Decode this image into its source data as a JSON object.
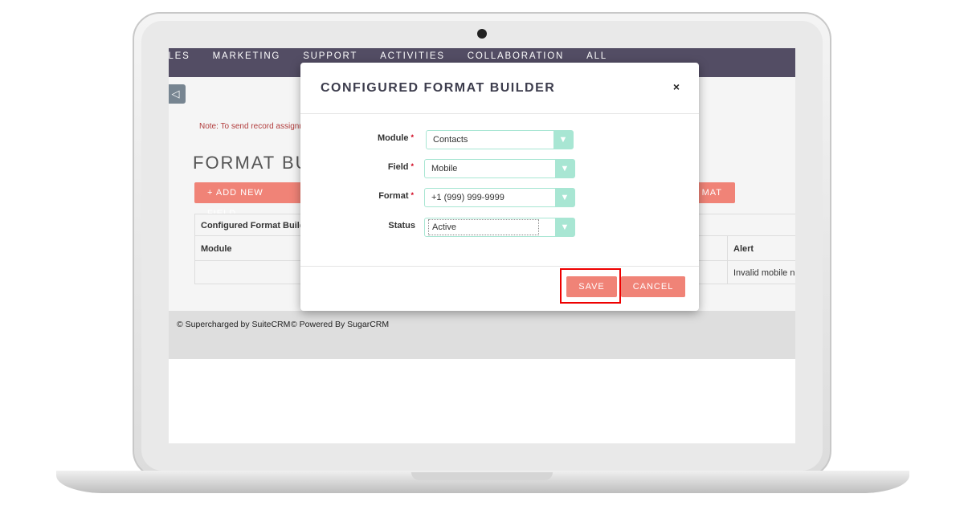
{
  "nav": [
    "ALES",
    "MARKETING",
    "SUPPORT",
    "ACTIVITIES",
    "COLLABORATION",
    "ALL"
  ],
  "page": {
    "back_icon": "◁",
    "note": "Note: To send record assignm",
    "title": "FORMAT BU",
    "add_button": "+ ADD NEW FIELD",
    "right_button": "MAT",
    "table": {
      "caption": "Configured Format Builde",
      "headers": [
        "Module",
        "Alert"
      ],
      "row": [
        "",
        "Invalid mobile nu"
      ]
    }
  },
  "footer": {
    "suitecrm": "© Supercharged by SuiteCRM",
    "sugarcrm": "© Powered By SugarCRM"
  },
  "modal": {
    "title": "CONFIGURED FORMAT BUILDER",
    "close": "×",
    "fields": [
      {
        "label": "Module",
        "required": true,
        "value": "Contacts"
      },
      {
        "label": "Field",
        "required": true,
        "value": "Mobile"
      },
      {
        "label": "Format",
        "required": true,
        "value": "+1 (999) 999-9999"
      },
      {
        "label": "Status",
        "required": false,
        "value": "Active"
      }
    ],
    "required_mark": "*",
    "save": "SAVE",
    "cancel": "CANCEL"
  },
  "colors": {
    "nav": "#534d64",
    "button": "#f08377",
    "select_accent": "#a8e6d3",
    "highlight": "#e00000"
  }
}
